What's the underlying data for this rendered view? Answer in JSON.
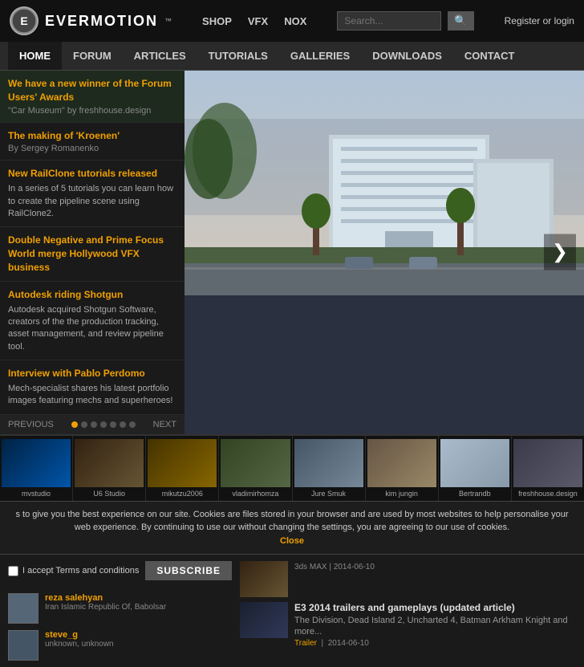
{
  "header": {
    "brand": "EVERMOTION",
    "tm": "™",
    "logo_text": "E",
    "top_nav": [
      {
        "label": "SHOP",
        "href": "#"
      },
      {
        "label": "VFX",
        "href": "#"
      },
      {
        "label": "NOX",
        "href": "#"
      }
    ],
    "search_placeholder": "Search...",
    "search_icon": "🔍",
    "auth_label": "Register or login"
  },
  "main_nav": [
    {
      "label": "HOME",
      "active": true
    },
    {
      "label": "FORUM",
      "active": false
    },
    {
      "label": "ARTICLES",
      "active": false
    },
    {
      "label": "TUTORIALS",
      "active": false
    },
    {
      "label": "GALLERIES",
      "active": false
    },
    {
      "label": "DOWNLOADS",
      "active": false
    },
    {
      "label": "CONTACT",
      "active": false
    }
  ],
  "sidebar": {
    "items": [
      {
        "title": "We have a new winner of the Forum Users' Awards",
        "subtitle": "\"Car Museum\" by freshhouse.design",
        "highlight": true
      },
      {
        "title": "The making of 'Kroenen'",
        "subtitle": "By Sergey Romanenko"
      },
      {
        "title": "New RailClone tutorials released",
        "body": "In a series of 5 tutorials you can learn how to create the pipeline scene using RailClone2."
      },
      {
        "title": "Double Negative and Prime Focus World merge Hollywood VFX business"
      },
      {
        "title": "Autodesk riding Shotgun",
        "body": "Autodesk acquired Shotgun Software, creators of the the production tracking, asset management, and review pipeline tool."
      },
      {
        "title": "Interview with Pablo Perdomo",
        "body": "Mech-specialist shares his latest portfolio images featuring mechs and superheroes!"
      }
    ],
    "prev_label": "PREVIOUS",
    "next_label": "NEXT",
    "dots": [
      true,
      false,
      false,
      false,
      false,
      false,
      false
    ]
  },
  "thumbnails": [
    {
      "label": "mvstudio",
      "color_class": "blue"
    },
    {
      "label": "U6 Studio",
      "color_class": "brown"
    },
    {
      "label": "mikutzu2006",
      "color_class": "gold"
    },
    {
      "label": "vladimirhomza",
      "color_class": "olive"
    },
    {
      "label": "Jure Smuk",
      "color_class": "room"
    },
    {
      "label": "kim jungin",
      "color_class": "desert"
    },
    {
      "label": "Bertrandb",
      "color_class": "arch"
    },
    {
      "label": "freshhouse.design",
      "color_class": "grey"
    }
  ],
  "cookie_bar": {
    "text": "s to give you the best experience on our site. Cookies are files stored in your browser and are used by most websites to help personalise your web experience. By continuing to use our without changing the settings, you are agreeing to our use of cookies.",
    "close_label": "Close"
  },
  "bottom": {
    "users": [
      {
        "name": "reza salehyan",
        "location": "Iran Islamic Republic Of, Babolsar"
      },
      {
        "name": "steve_g",
        "location": "unknown, unknown"
      }
    ],
    "subscribe": {
      "checkbox_label": "I accept Terms and conditions",
      "button_label": "SUBSCRIBE"
    },
    "news_items": [
      {
        "title": "3ds MAX  |  2014-06-10",
        "thumb_color": "brown"
      },
      {
        "title": "E3 2014 trailers and gameplays (updated article)",
        "body": "The Division, Dead Island 2, Uncharted 4, Batman Arkham Knight and more...",
        "tag": "Trailer",
        "date": "2014-06-10"
      }
    ]
  },
  "banner_arrow": "❯"
}
